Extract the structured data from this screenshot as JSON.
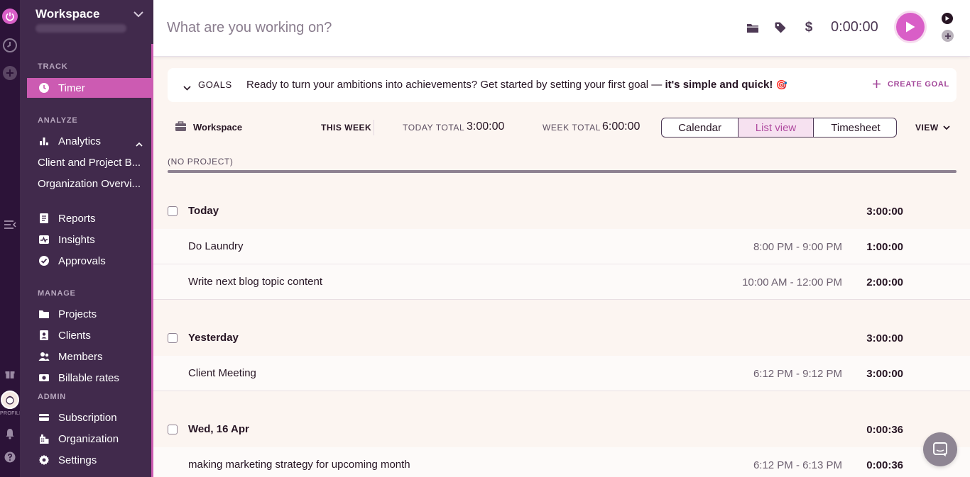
{
  "sidebar": {
    "workspace_name": "Workspace",
    "sections": {
      "track": "TRACK",
      "analyze": "ANALYZE",
      "manage": "MANAGE",
      "admin": "ADMIN"
    },
    "items": {
      "timer": "Timer",
      "analytics": "Analytics",
      "client_project": "Client and Project B...",
      "org_overview": "Organization Overvi...",
      "reports": "Reports",
      "insights": "Insights",
      "approvals": "Approvals",
      "projects": "Projects",
      "clients": "Clients",
      "members": "Members",
      "billable_rates": "Billable rates",
      "subscription": "Subscription",
      "organization": "Organization",
      "settings": "Settings"
    },
    "profile_label": "PROFILE"
  },
  "timer": {
    "placeholder": "What are you working on?",
    "elapsed": "0:00:00"
  },
  "goals": {
    "label": "GOALS",
    "message_plain": "Ready to turn your ambitions into achievements? Get started by setting your first goal — ",
    "message_bold": "it's simple and quick!",
    "emoji": "🎯",
    "create_label": "CREATE GOAL"
  },
  "filters": {
    "workspace": "Workspace",
    "period": "THIS WEEK",
    "today_total_label": "TODAY TOTAL",
    "today_total": "3:00:00",
    "week_total_label": "WEEK TOTAL",
    "week_total": "6:00:00",
    "views": [
      "Calendar",
      "List view",
      "Timesheet"
    ],
    "active_view": "List view",
    "view_menu": "VIEW"
  },
  "project_breakdown": {
    "label": "(NO PROJECT)",
    "share": 1.0
  },
  "days": [
    {
      "label": "Today",
      "total": "3:00:00",
      "entries": [
        {
          "description": "Do Laundry",
          "range": "8:00 PM - 9:00 PM",
          "duration": "1:00:00"
        },
        {
          "description": "Write next blog topic content",
          "range": "10:00 AM - 12:00 PM",
          "duration": "2:00:00"
        }
      ]
    },
    {
      "label": "Yesterday",
      "total": "3:00:00",
      "entries": [
        {
          "description": "Client Meeting",
          "range": "6:12 PM - 9:12 PM",
          "duration": "3:00:00"
        }
      ]
    },
    {
      "label": "Wed, 16 Apr",
      "total": "0:00:36",
      "entries": [
        {
          "description": "making marketing strategy for upcoming month",
          "range": "6:12 PM - 6:13 PM",
          "duration": "0:00:36"
        }
      ]
    }
  ],
  "colors": {
    "brand": "#d95ec7",
    "sidebar": "#412a4c",
    "rail": "#2c1338",
    "active_item": "#cc5bb2",
    "accent_text": "#a3479a"
  }
}
